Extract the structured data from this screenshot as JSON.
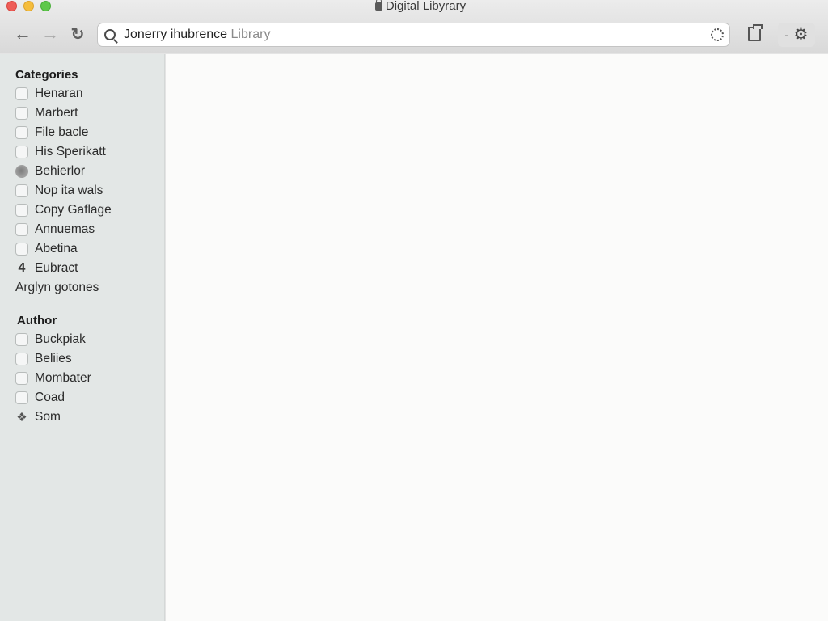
{
  "window": {
    "title": "Digital Libyrary"
  },
  "toolbar": {
    "back_icon": "arrow-left",
    "forward_icon": "arrow-right",
    "reload_icon": "reload",
    "url_query": "Jonerry ihubrence",
    "url_suffix": "Library",
    "bookmark_icon": "document",
    "settings_dash": "-",
    "settings_icon": "gear"
  },
  "sidebar": {
    "categories": {
      "title": "Categories",
      "items": [
        {
          "label": "Henaran",
          "icon": "checkbox"
        },
        {
          "label": "Marbert",
          "icon": "checkbox"
        },
        {
          "label": "File bacle",
          "icon": "checkbox"
        },
        {
          "label": "His Sperikatt",
          "icon": "checkbox"
        },
        {
          "label": "Behierlor",
          "icon": "globe"
        },
        {
          "label": "Nop ita wals",
          "icon": "checkbox"
        },
        {
          "label": "Copy Gaflage",
          "icon": "checkbox"
        },
        {
          "label": "Annuemas",
          "icon": "checkbox"
        },
        {
          "label": "Abetina",
          "icon": "checkbox"
        },
        {
          "label": "Eubract",
          "icon": "four"
        },
        {
          "label": "Arglyn gotones",
          "icon": "none"
        }
      ]
    },
    "author": {
      "title": "Author",
      "items": [
        {
          "label": "Buckpiak",
          "icon": "checkbox"
        },
        {
          "label": "Beliies",
          "icon": "checkbox"
        },
        {
          "label": "Mombater",
          "icon": "checkbox"
        },
        {
          "label": "Coad",
          "icon": "checkbox"
        },
        {
          "label": "Som",
          "icon": "badge"
        }
      ]
    }
  }
}
